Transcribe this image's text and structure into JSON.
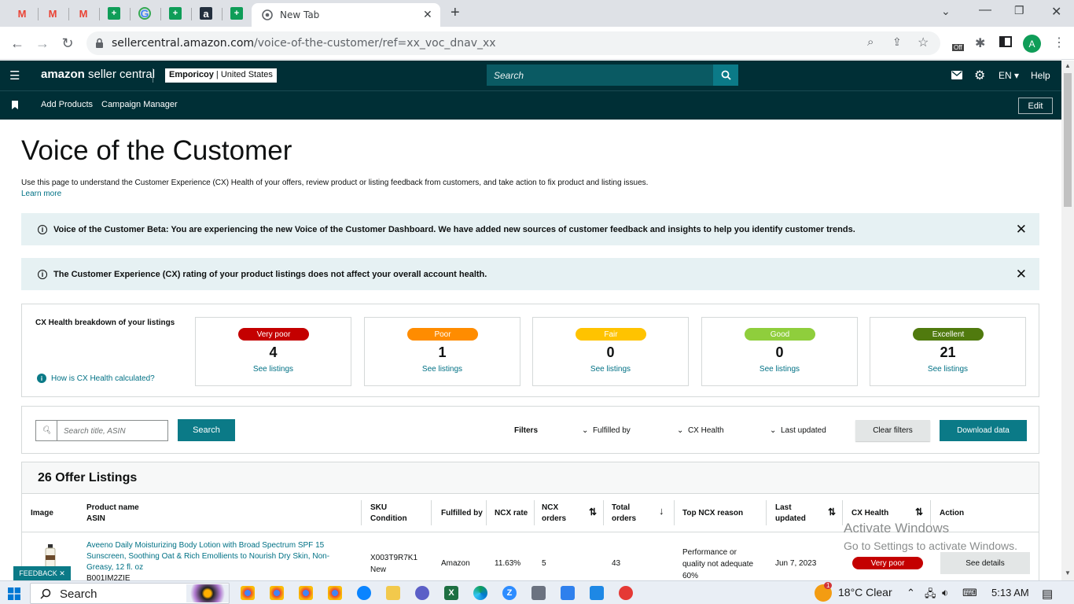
{
  "browser": {
    "tabs": [
      {
        "icon": "gmail-icon",
        "label": "M",
        "color": "#ea4335"
      },
      {
        "icon": "gmail-icon",
        "label": "M",
        "color": "#ea4335"
      },
      {
        "icon": "gmail-icon",
        "label": "M",
        "color": "#ea4335"
      },
      {
        "icon": "sheets-icon",
        "label": "+",
        "color": "#0f9d58"
      },
      {
        "icon": "google-icon",
        "label": "G",
        "color": "#4285f4"
      },
      {
        "icon": "sheets-icon",
        "label": "+",
        "color": "#0f9d58"
      },
      {
        "icon": "amazon-icon",
        "label": "a",
        "color": "#232f3e"
      },
      {
        "icon": "sheets-icon",
        "label": "+",
        "color": "#0f9d58"
      }
    ],
    "active_tab_title": "New Tab",
    "url_host": "sellercentral.amazon.com",
    "url_path": "/voice-of-the-customer/ref=xx_voc_dnav_xx",
    "profile_initial": "A",
    "ext_badge": "Off"
  },
  "header": {
    "logo_brand": "amazon",
    "logo_product": "seller central",
    "store_name": "Empori",
    "store_suffix": "coy",
    "store_region": "United States",
    "search_placeholder": "Search",
    "lang": "EN",
    "help": "Help",
    "sub_links": [
      "Add Products",
      "Campaign Manager"
    ],
    "edit": "Edit"
  },
  "page": {
    "title": "Voice of the Customer",
    "description": "Use this page to understand the Customer Experience (CX) Health of your offers, review product or listing feedback from customers, and take action to fix product and listing issues.",
    "learn_more": "Learn more",
    "banner1": "Voice of the Customer Beta: You are experiencing the new Voice of the Customer Dashboard. We have added new sources of customer feedback and insights to help you identify customer trends.",
    "banner2": "The Customer Experience (CX) rating of your product listings does not affect your overall account health."
  },
  "cx": {
    "label": "CX Health breakdown of your listings",
    "calc_link": "How is CX Health calculated?",
    "cards": [
      {
        "rating": "Very poor",
        "count": "4",
        "link": "See listings",
        "color": "#c40000"
      },
      {
        "rating": "Poor",
        "count": "1",
        "link": "See listings",
        "color": "#ff8c00"
      },
      {
        "rating": "Fair",
        "count": "0",
        "link": "See listings",
        "color": "#ffc300"
      },
      {
        "rating": "Good",
        "count": "0",
        "link": "See listings",
        "color": "#8fce3c"
      },
      {
        "rating": "Excellent",
        "count": "21",
        "link": "See listings",
        "color": "#507a0e"
      }
    ]
  },
  "filters": {
    "search_placeholder": "Search title, ASIN",
    "search_button": "Search",
    "label": "Filters",
    "fulfilled_by": "Fulfilled by",
    "cx_health": "CX Health",
    "last_updated": "Last updated",
    "clear": "Clear filters",
    "download": "Download data"
  },
  "listings": {
    "title": "26 Offer Listings",
    "columns": {
      "image": "Image",
      "product_name": "Product name",
      "asin": "ASIN",
      "sku": "SKU",
      "condition": "Condition",
      "fulfilled_by": "Fulfilled by",
      "ncx_rate": "NCX rate",
      "ncx_orders_1": "NCX",
      "ncx_orders_2": "orders",
      "total_orders_1": "Total",
      "total_orders_2": "orders",
      "top_reason": "Top NCX reason",
      "last_updated_1": "Last",
      "last_updated_2": "updated",
      "cx_health": "CX Health",
      "action": "Action"
    },
    "row": {
      "product_name": "Aveeno Daily Moisturizing Body Lotion with Broad Spectrum SPF 15 Sunscreen, Soothing Oat & Rich Emollients to Nourish Dry Skin, Non-Greasy, 12 fl. oz",
      "asin": "B001IM2ZIE",
      "sku": "X003T9R7K1",
      "condition": "New",
      "fulfilled_by": "Amazon",
      "ncx_rate": "11.63%",
      "ncx_orders": "5",
      "total_orders": "43",
      "top_reason_1": "Performance or",
      "top_reason_2": "quality not adequate",
      "top_reason_3": "60%",
      "last_updated": "Jun 7, 2023",
      "cx_health": "Very poor",
      "action": "See details"
    }
  },
  "feedback": "FEEDBACK",
  "watermark": {
    "line1": "Activate Windows",
    "line2": "Go to Settings to activate Windows."
  },
  "taskbar": {
    "search": "Search",
    "weather": "18°C  Clear",
    "time": "5:13 AM",
    "notif_count": "1"
  }
}
